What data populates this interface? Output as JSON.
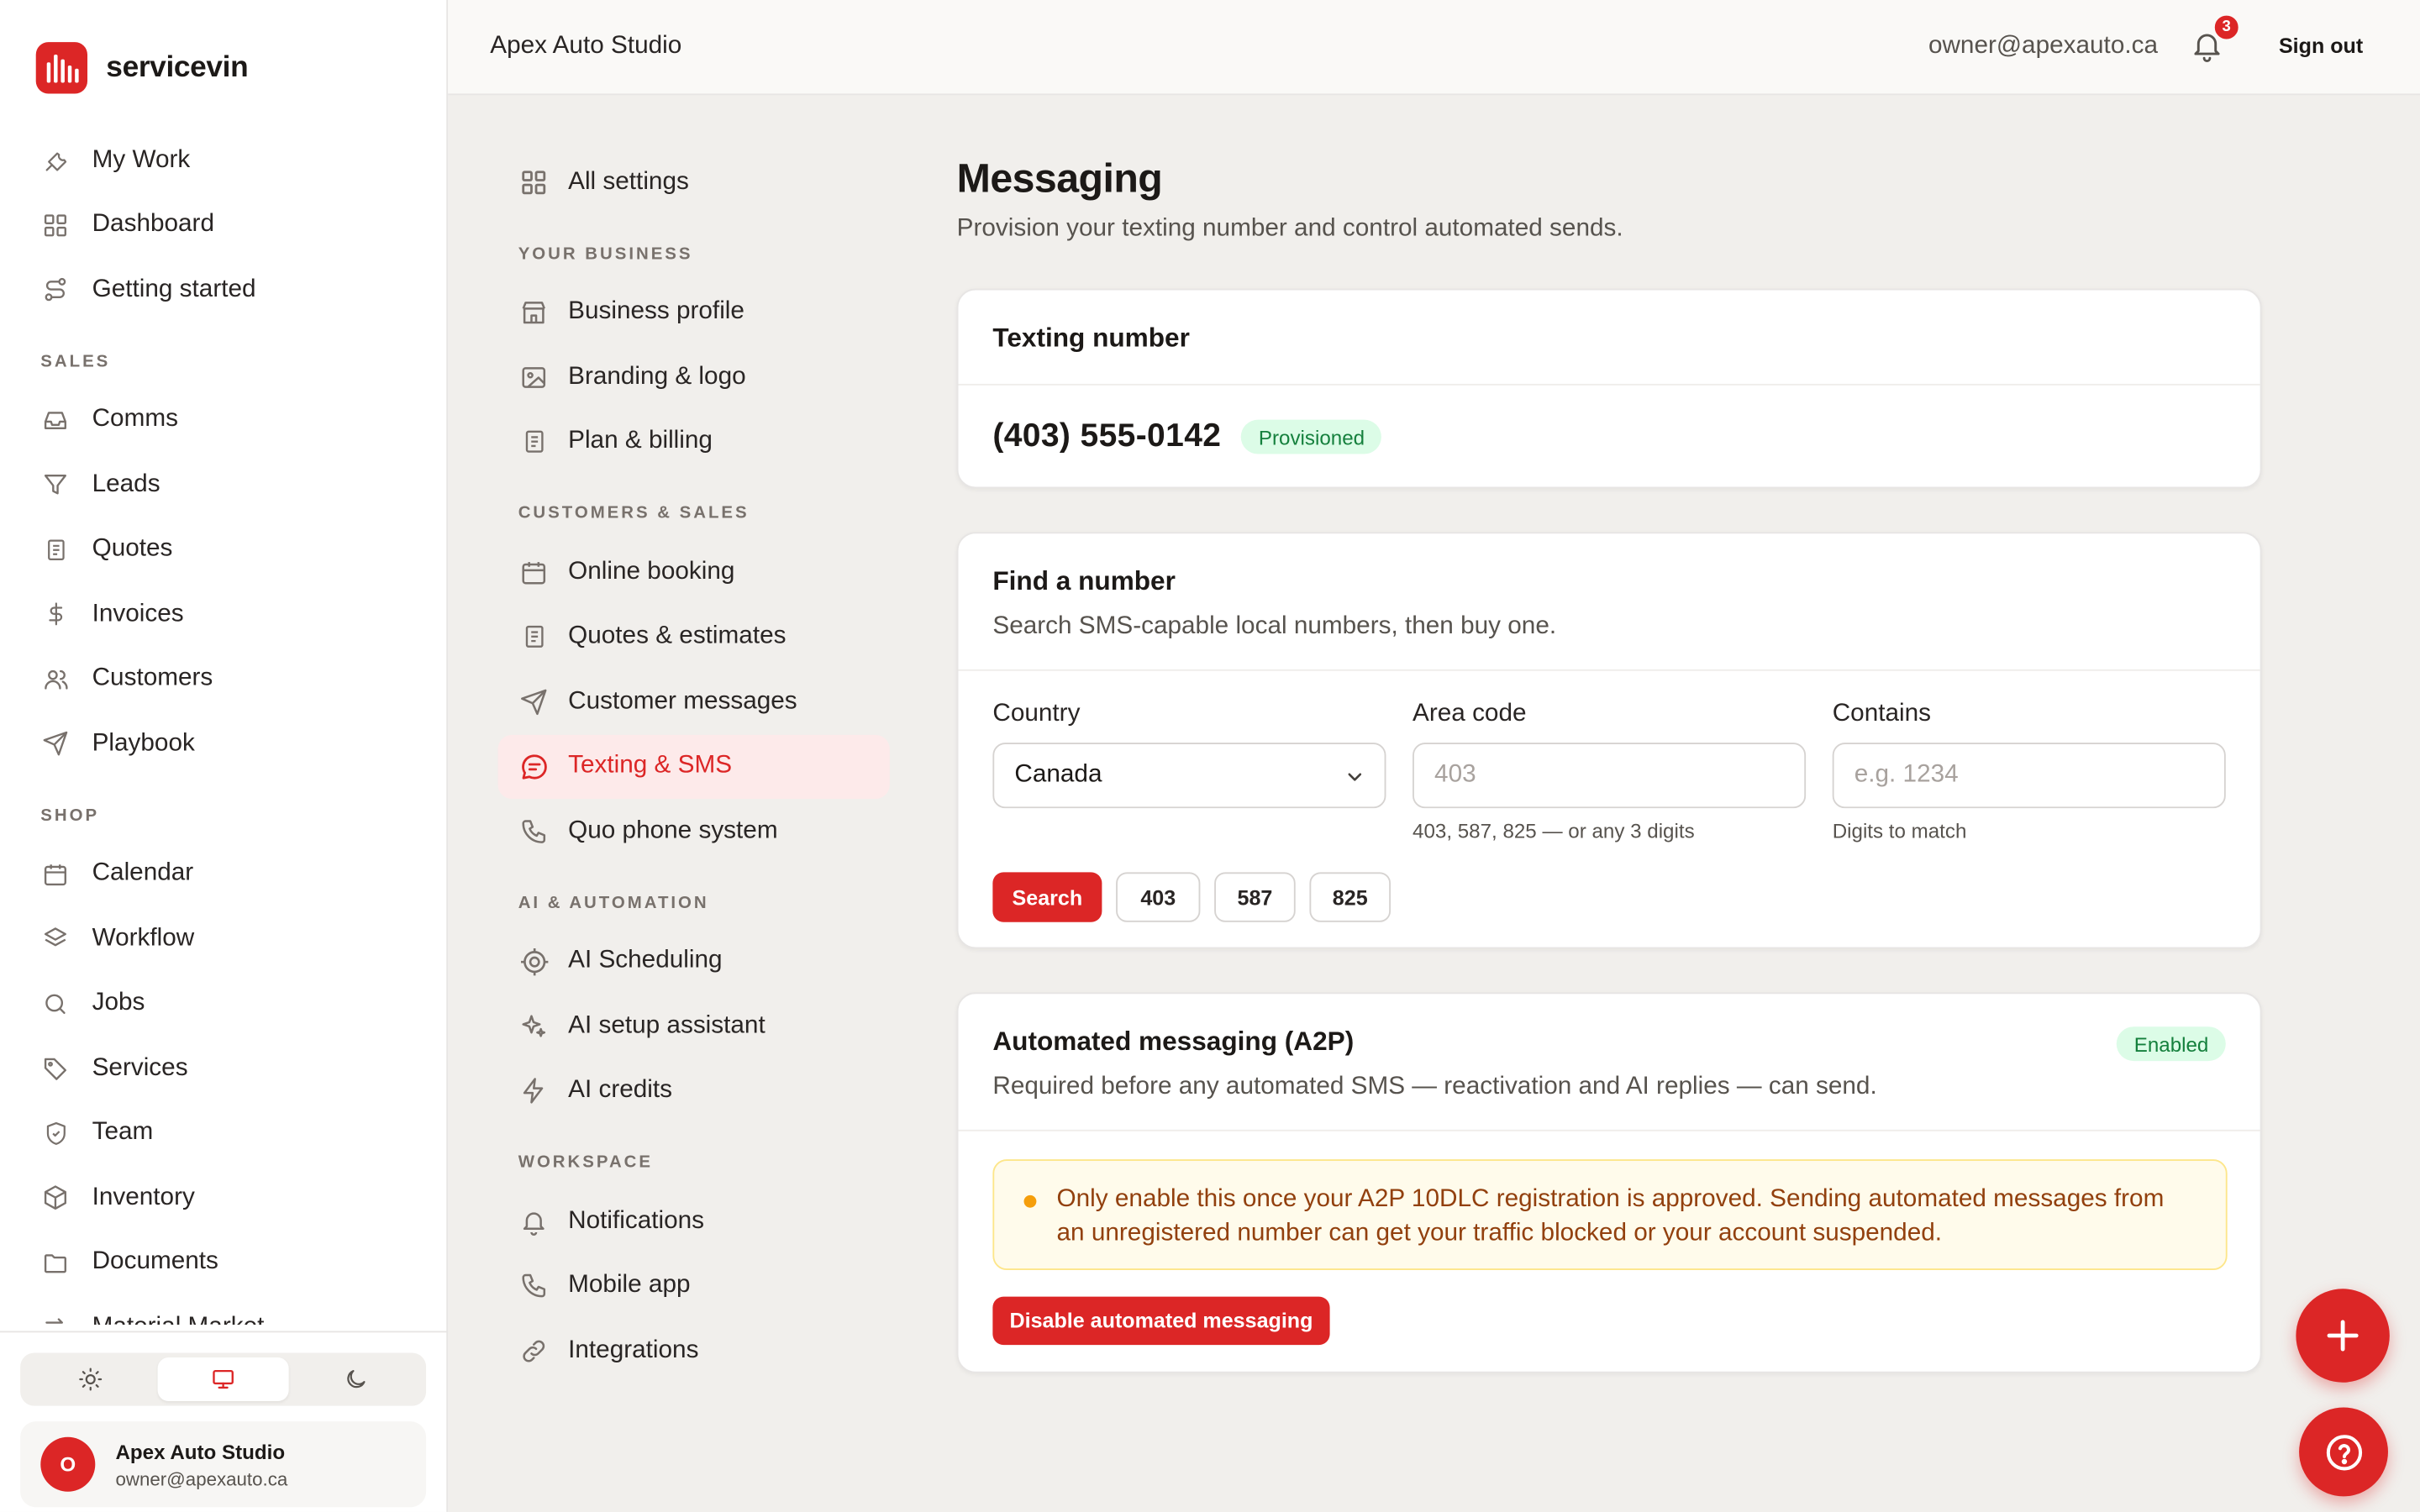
{
  "brand": {
    "name": "servicevin"
  },
  "sidebar": {
    "top_items": [
      {
        "label": "My Work",
        "icon": "wrench-icon"
      },
      {
        "label": "Dashboard",
        "icon": "grid-icon"
      },
      {
        "label": "Getting started",
        "icon": "route-icon"
      }
    ],
    "sections": [
      {
        "title": "SALES",
        "items": [
          {
            "label": "Comms",
            "icon": "inbox-icon"
          },
          {
            "label": "Leads",
            "icon": "funnel-icon"
          },
          {
            "label": "Quotes",
            "icon": "document-icon"
          },
          {
            "label": "Invoices",
            "icon": "dollar-icon"
          },
          {
            "label": "Customers",
            "icon": "users-icon"
          },
          {
            "label": "Playbook",
            "icon": "send-icon"
          }
        ]
      },
      {
        "title": "SHOP",
        "items": [
          {
            "label": "Calendar",
            "icon": "calendar-icon"
          },
          {
            "label": "Workflow",
            "icon": "layers-icon"
          },
          {
            "label": "Jobs",
            "icon": "search-icon"
          },
          {
            "label": "Services",
            "icon": "tag-icon"
          },
          {
            "label": "Team",
            "icon": "shield-icon"
          },
          {
            "label": "Inventory",
            "icon": "box-icon"
          },
          {
            "label": "Documents",
            "icon": "folder-icon"
          },
          {
            "label": "Material Market",
            "icon": "arrows-icon"
          }
        ]
      }
    ],
    "theme_modes": [
      "light",
      "system",
      "dark"
    ],
    "theme_active": "system",
    "account": {
      "initial": "O",
      "name": "Apex Auto Studio",
      "email": "owner@apexauto.ca"
    }
  },
  "topbar": {
    "title": "Apex Auto Studio",
    "email": "owner@apexauto.ca",
    "notification_count": "3",
    "signout_label": "Sign out"
  },
  "settings_nav": {
    "all_settings": "All settings",
    "sections": [
      {
        "title": "YOUR BUSINESS",
        "items": [
          {
            "label": "Business profile",
            "icon": "store-icon"
          },
          {
            "label": "Branding & logo",
            "icon": "image-icon"
          },
          {
            "label": "Plan & billing",
            "icon": "document-icon"
          }
        ]
      },
      {
        "title": "CUSTOMERS & SALES",
        "items": [
          {
            "label": "Online booking",
            "icon": "calendar-icon"
          },
          {
            "label": "Quotes & estimates",
            "icon": "document-icon"
          },
          {
            "label": "Customer messages",
            "icon": "send-icon"
          },
          {
            "label": "Texting & SMS",
            "icon": "chat-icon",
            "active": true
          },
          {
            "label": "Quo phone system",
            "icon": "phone-icon"
          }
        ]
      },
      {
        "title": "AI & AUTOMATION",
        "items": [
          {
            "label": "AI Scheduling",
            "icon": "target-icon"
          },
          {
            "label": "AI setup assistant",
            "icon": "sparkles-icon"
          },
          {
            "label": "AI credits",
            "icon": "bolt-icon"
          }
        ]
      },
      {
        "title": "WORKSPACE",
        "items": [
          {
            "label": "Notifications",
            "icon": "bell-icon"
          },
          {
            "label": "Mobile app",
            "icon": "phone-icon"
          },
          {
            "label": "Integrations",
            "icon": "link-icon"
          }
        ]
      }
    ]
  },
  "main": {
    "title": "Messaging",
    "subtitle": "Provision your texting number and control automated sends.",
    "texting_number": {
      "title": "Texting number",
      "number": "(403) 555-0142",
      "status": "Provisioned"
    },
    "find_number": {
      "title": "Find a number",
      "description": "Search SMS-capable local numbers, then buy one.",
      "country_label": "Country",
      "country_value": "Canada",
      "area_code_label": "Area code",
      "area_code_placeholder": "403",
      "area_code_help": "403, 587, 825 — or any 3 digits",
      "contains_label": "Contains",
      "contains_placeholder": "e.g. 1234",
      "contains_help": "Digits to match",
      "search_label": "Search",
      "quick_codes": [
        "403",
        "587",
        "825"
      ]
    },
    "automated": {
      "title": "Automated messaging (A2P)",
      "status": "Enabled",
      "description": "Required before any automated SMS — reactivation and AI replies — can send.",
      "warning": "Only enable this once your A2P 10DLC registration is approved. Sending automated messages from an unregistered number can get your traffic blocked or your account suspended.",
      "disable_label": "Disable automated messaging"
    }
  },
  "fabs": {
    "add": "plus-icon",
    "help": "help-icon"
  },
  "colors": {
    "accent": "#dc2626",
    "success": "#15803d",
    "warning": "#f59e0b"
  }
}
